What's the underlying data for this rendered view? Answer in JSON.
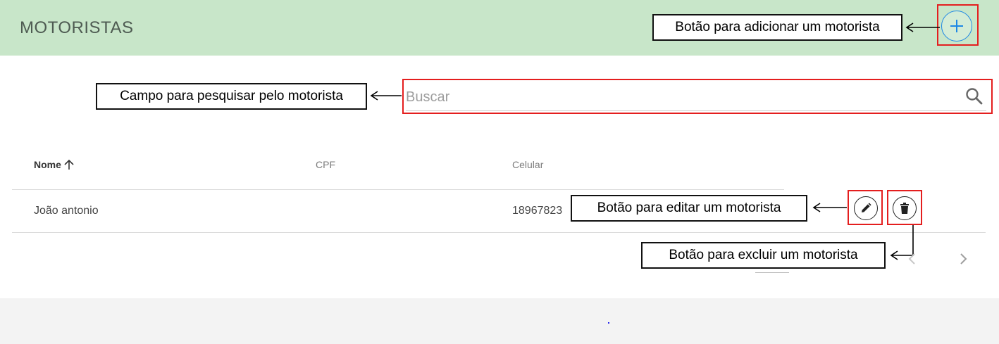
{
  "header": {
    "title": "MOTORISTAS",
    "add_button_icon": "plus-icon",
    "bg_color": "#c8e6c9",
    "accent_color": "#1e88e5"
  },
  "search": {
    "placeholder": "Buscar",
    "value": "",
    "icon": "search-icon"
  },
  "table": {
    "columns": [
      "Nome",
      "CPF",
      "Celular"
    ],
    "sort_icon": "arrow-up-icon",
    "rows": [
      {
        "nome": "João antonio",
        "cpf": "",
        "celular": "18967823"
      }
    ],
    "row_actions": [
      "edit-icon",
      "trash-icon"
    ]
  },
  "pagination": {
    "prev_icon": "chevron-left-icon",
    "next_icon": "chevron-right-icon"
  },
  "annotations": {
    "add": "Botão para adicionar um motorista",
    "search": "Campo para pesquisar pelo motorista",
    "edit": "Botão para editar um motorista",
    "delete": "Botão para excluir um motorista",
    "highlight_color": "#e41e1e"
  }
}
